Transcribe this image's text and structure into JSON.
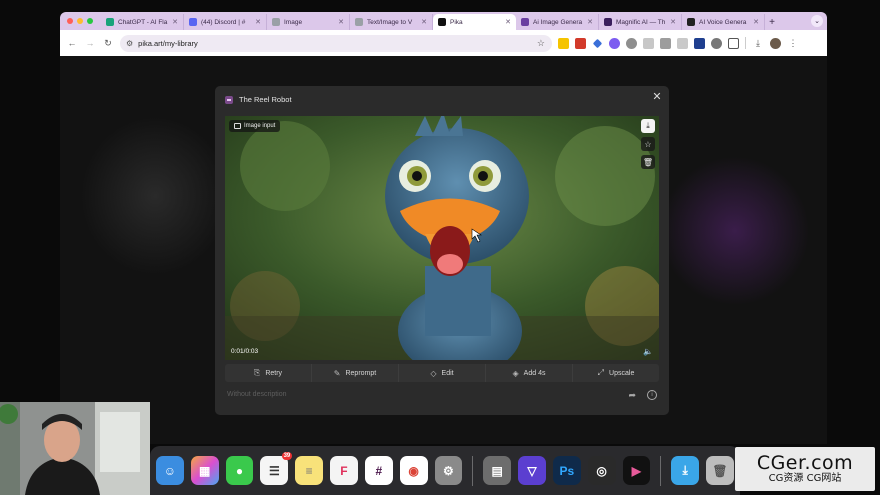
{
  "browser": {
    "tabs": [
      {
        "label": "ChatGPT - AI Fla",
        "icon": "chatgpt-icon",
        "color": "#19a37a",
        "active": false
      },
      {
        "label": "(44) Discord | #",
        "icon": "discord-icon",
        "color": "#5865f2",
        "active": false
      },
      {
        "label": "Image",
        "icon": "page-icon",
        "color": "#9aa0a6",
        "active": false
      },
      {
        "label": "Text/Image to V",
        "icon": "page-icon",
        "color": "#9aa0a6",
        "active": false
      },
      {
        "label": "Pika",
        "icon": "pika-icon",
        "color": "#111111",
        "active": true
      },
      {
        "label": "Ai Image Genera",
        "icon": "ai-icon",
        "color": "#6a3fa0",
        "active": false
      },
      {
        "label": "Magnific AI — Th",
        "icon": "magnific-icon",
        "color": "#3a1f5c",
        "active": false
      },
      {
        "label": "AI Voice Genera",
        "icon": "voice-icon",
        "color": "#222222",
        "active": false
      }
    ],
    "url": "pika.art/my-library",
    "accent": "#dcc8ea"
  },
  "modal": {
    "title": "The Reel Robot",
    "badge": "Image input",
    "timecode": "0:01/0:03",
    "actions": [
      {
        "label": "Retry",
        "icon": "retry-icon",
        "glyph": "⎘"
      },
      {
        "label": "Reprompt",
        "icon": "edit-icon",
        "glyph": "✎"
      },
      {
        "label": "Edit",
        "icon": "tag-icon",
        "glyph": "◇"
      },
      {
        "label": "Add 4s",
        "icon": "extend-icon",
        "glyph": "◈"
      },
      {
        "label": "Upscale",
        "icon": "expand-icon",
        "glyph": "⤢"
      }
    ],
    "description": "Without description"
  },
  "dock": {
    "badge_count": "39"
  },
  "watermark": {
    "main": "CGer.com",
    "sub": "CG资源 CG网站"
  }
}
